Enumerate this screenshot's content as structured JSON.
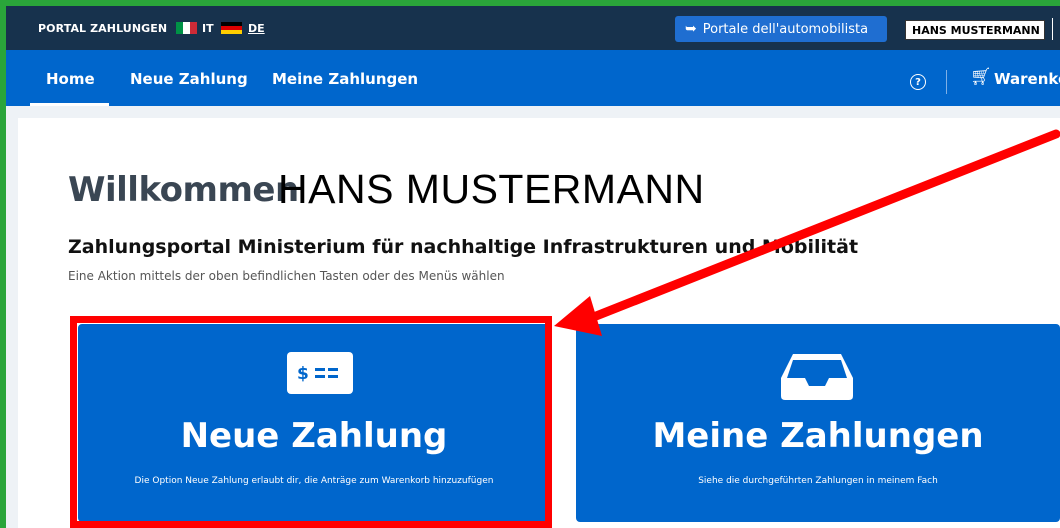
{
  "topbar": {
    "portal_title": "PORTAL ZAHLUNGEN",
    "lang_it": "IT",
    "lang_de": "DE",
    "automobilista_link": "Portale dell'automobilista",
    "user_name": "HANS MUSTERMANN"
  },
  "nav": {
    "home": "Home",
    "new_payment": "Neue Zahlung",
    "my_payments": "Meine Zahlungen",
    "help": "?",
    "cart": "Warenko"
  },
  "main": {
    "welcome": "Willkommen",
    "user_name": "HANS MUSTERMANN",
    "subtitle": "Zahlungsportal Ministerium für nachhaltige Infrastrukturen und Mobilität",
    "hint": "Eine Aktion mittels der oben befindlichen Tasten oder des Menüs wählen"
  },
  "tiles": [
    {
      "title": "Neue Zahlung",
      "description": "Die Option Neue Zahlung erlaubt dir, die Anträge zum Warenkorb hinzuzufügen",
      "icon": "dollar-card-icon"
    },
    {
      "title": "Meine Zahlungen",
      "description": "Siehe die durchgeführten Zahlungen in meinem Fach",
      "icon": "inbox-icon"
    }
  ],
  "colors": {
    "topbar": "#17324d",
    "navbar": "#0066cc",
    "tile": "#0066cc",
    "highlight": "#ff0000",
    "frame": "#2aa53a"
  }
}
